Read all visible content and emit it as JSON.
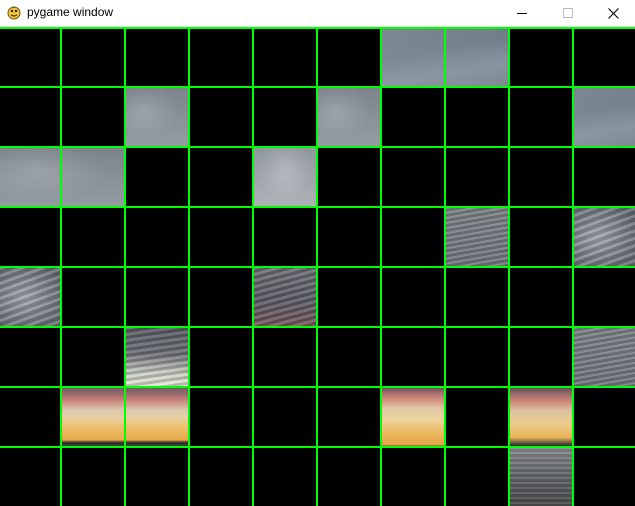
{
  "window": {
    "title": "pygame window",
    "app_icon": "pygame-snake-icon",
    "controls": {
      "minimize_icon": "minimize-icon",
      "maximize_icon": "maximize-icon",
      "close_icon": "close-icon"
    }
  },
  "game": {
    "background_color": "#000000",
    "grid_color": "#00ff00",
    "grid": {
      "columns": 10,
      "rows": 8
    },
    "revealed_tiles": [
      {
        "col": 6,
        "row": 0,
        "span": 2,
        "texture": "sky-blue"
      },
      {
        "col": 2,
        "row": 1,
        "span": 1,
        "texture": "sky-grey"
      },
      {
        "col": 5,
        "row": 1,
        "span": 1,
        "texture": "sky-grey"
      },
      {
        "col": 9,
        "row": 1,
        "span": 1,
        "texture": "sky-blue"
      },
      {
        "col": 0,
        "row": 2,
        "span": 2,
        "texture": "sky-grey"
      },
      {
        "col": 4,
        "row": 2,
        "span": 1,
        "texture": "sky-light"
      },
      {
        "col": 7,
        "row": 3,
        "span": 1,
        "texture": "cloud-mid"
      },
      {
        "col": 9,
        "row": 3,
        "span": 1,
        "texture": "cloud-grey"
      },
      {
        "col": 0,
        "row": 4,
        "span": 1,
        "texture": "cloud-grey"
      },
      {
        "col": 4,
        "row": 4,
        "span": 1,
        "texture": "cloud-dark"
      },
      {
        "col": 2,
        "row": 5,
        "span": 1,
        "texture": "cloud-horizon"
      },
      {
        "col": 9,
        "row": 5,
        "span": 1,
        "texture": "cloud-mid"
      },
      {
        "col": 1,
        "row": 6,
        "span": 2,
        "texture": "sunset-wide"
      },
      {
        "col": 6,
        "row": 6,
        "span": 1,
        "texture": "sunset-a"
      },
      {
        "col": 8,
        "row": 6,
        "span": 1,
        "texture": "sunset-b"
      },
      {
        "col": 8,
        "row": 7,
        "span": 1,
        "texture": "sea"
      }
    ]
  }
}
